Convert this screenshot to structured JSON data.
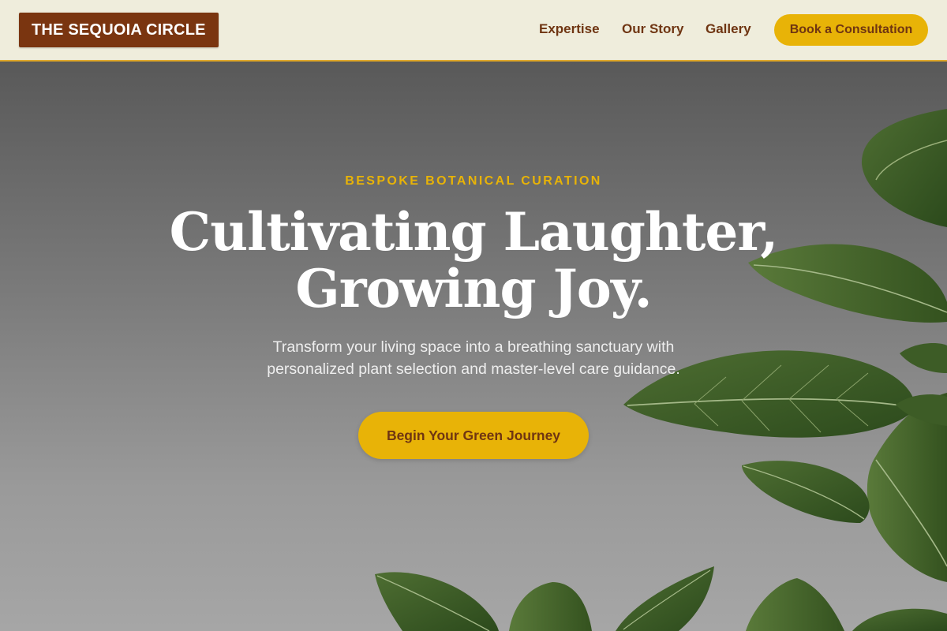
{
  "brand": {
    "logo_text": "THE SEQUOIA CIRCLE"
  },
  "nav": {
    "items": [
      {
        "label": "Expertise"
      },
      {
        "label": "Our Story"
      },
      {
        "label": "Gallery"
      }
    ],
    "cta_label": "Book a Consultation"
  },
  "hero": {
    "eyebrow": "BESPOKE BOTANICAL CURATION",
    "headline_line1": "Cultivating Laughter,",
    "headline_line2": "Growing Joy.",
    "subtext": "Transform your living space into a breathing sanctuary with personalized plant selection and master-level care guidance.",
    "cta_label": "Begin Your Green Journey"
  },
  "colors": {
    "brand_brown": "#7a3510",
    "accent_gold": "#e8b307",
    "header_bg": "#efeddc",
    "text_brown": "#6f3512"
  }
}
